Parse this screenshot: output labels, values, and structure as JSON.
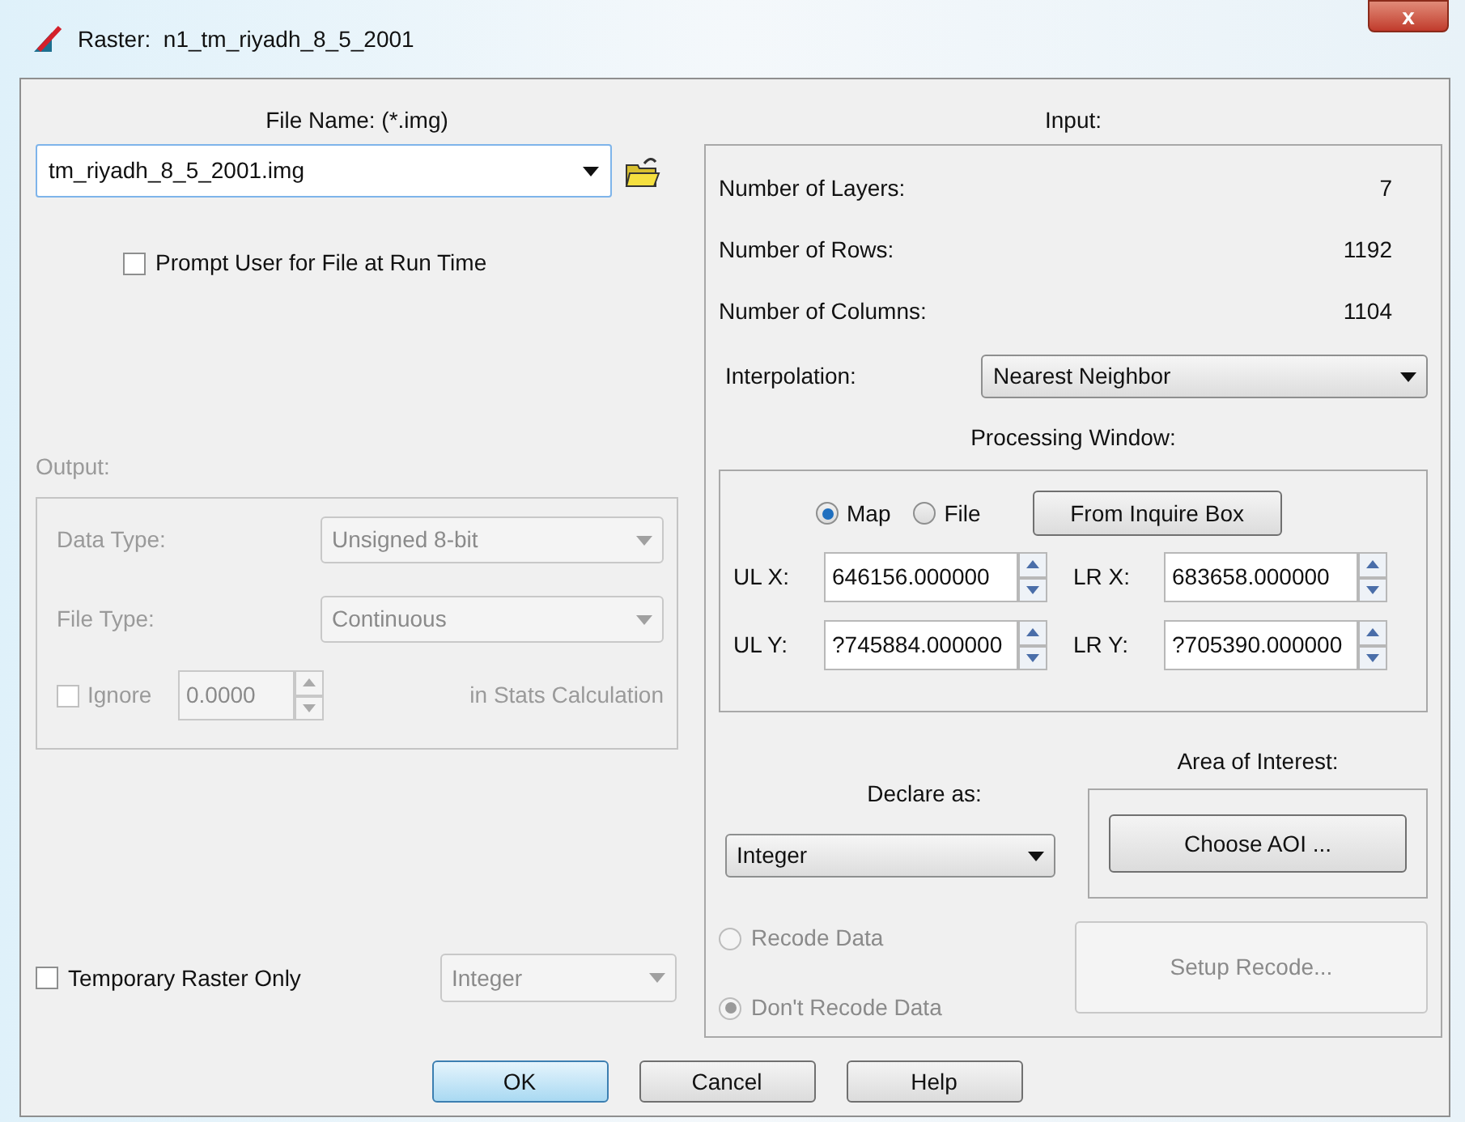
{
  "window": {
    "title": "Raster:  n1_tm_riyadh_8_5_2001",
    "close": "x"
  },
  "file_name": {
    "label": "File Name: (*.img)",
    "value": "tm_riyadh_8_5_2001.img"
  },
  "prompt_checkbox": {
    "label": "Prompt User for File at Run Time",
    "checked": false
  },
  "output": {
    "label": "Output:",
    "disabled": true,
    "data_type": {
      "label": "Data Type:",
      "value": "Unsigned 8-bit"
    },
    "file_type": {
      "label": "File Type:",
      "value": "Continuous"
    },
    "ignore": {
      "label": "Ignore",
      "checked": false,
      "value": "0.0000",
      "suffix": "in Stats Calculation"
    }
  },
  "temporary": {
    "label": "Temporary Raster Only",
    "checked": false,
    "value": "Integer",
    "disabled": true
  },
  "input": {
    "title": "Input:",
    "stats": [
      {
        "label": "Number of Layers:",
        "value": "7"
      },
      {
        "label": "Number of Rows:",
        "value": "1192"
      },
      {
        "label": "Number of Columns:",
        "value": "1104"
      }
    ],
    "interpolation": {
      "label": "Interpolation:",
      "value": "Nearest Neighbor"
    },
    "processing_window": {
      "title": "Processing Window:",
      "modes": [
        {
          "label": "Map",
          "selected": true
        },
        {
          "label": "File",
          "selected": false
        }
      ],
      "inquire_button": "From Inquire Box",
      "fields": [
        {
          "label": "UL X:",
          "value": "646156.000000"
        },
        {
          "label": "LR X:",
          "value": "683658.000000"
        },
        {
          "label": "UL Y:",
          "value": "?745884.000000"
        },
        {
          "label": "LR Y:",
          "value": "?705390.000000"
        }
      ]
    },
    "declare": {
      "label": "Declare as:",
      "value": "Integer"
    },
    "aoi": {
      "title": "Area of Interest:",
      "button": "Choose AOI ..."
    },
    "recode": [
      {
        "label": "Recode Data",
        "selected": false,
        "disabled": true
      },
      {
        "label": "Don't Recode Data",
        "selected": true,
        "disabled": true
      }
    ],
    "setup_button": {
      "label": "Setup Recode...",
      "disabled": true
    }
  },
  "buttons": [
    {
      "label": "OK",
      "default": true
    },
    {
      "label": "Cancel",
      "default": false
    },
    {
      "label": "Help",
      "default": false
    }
  ]
}
